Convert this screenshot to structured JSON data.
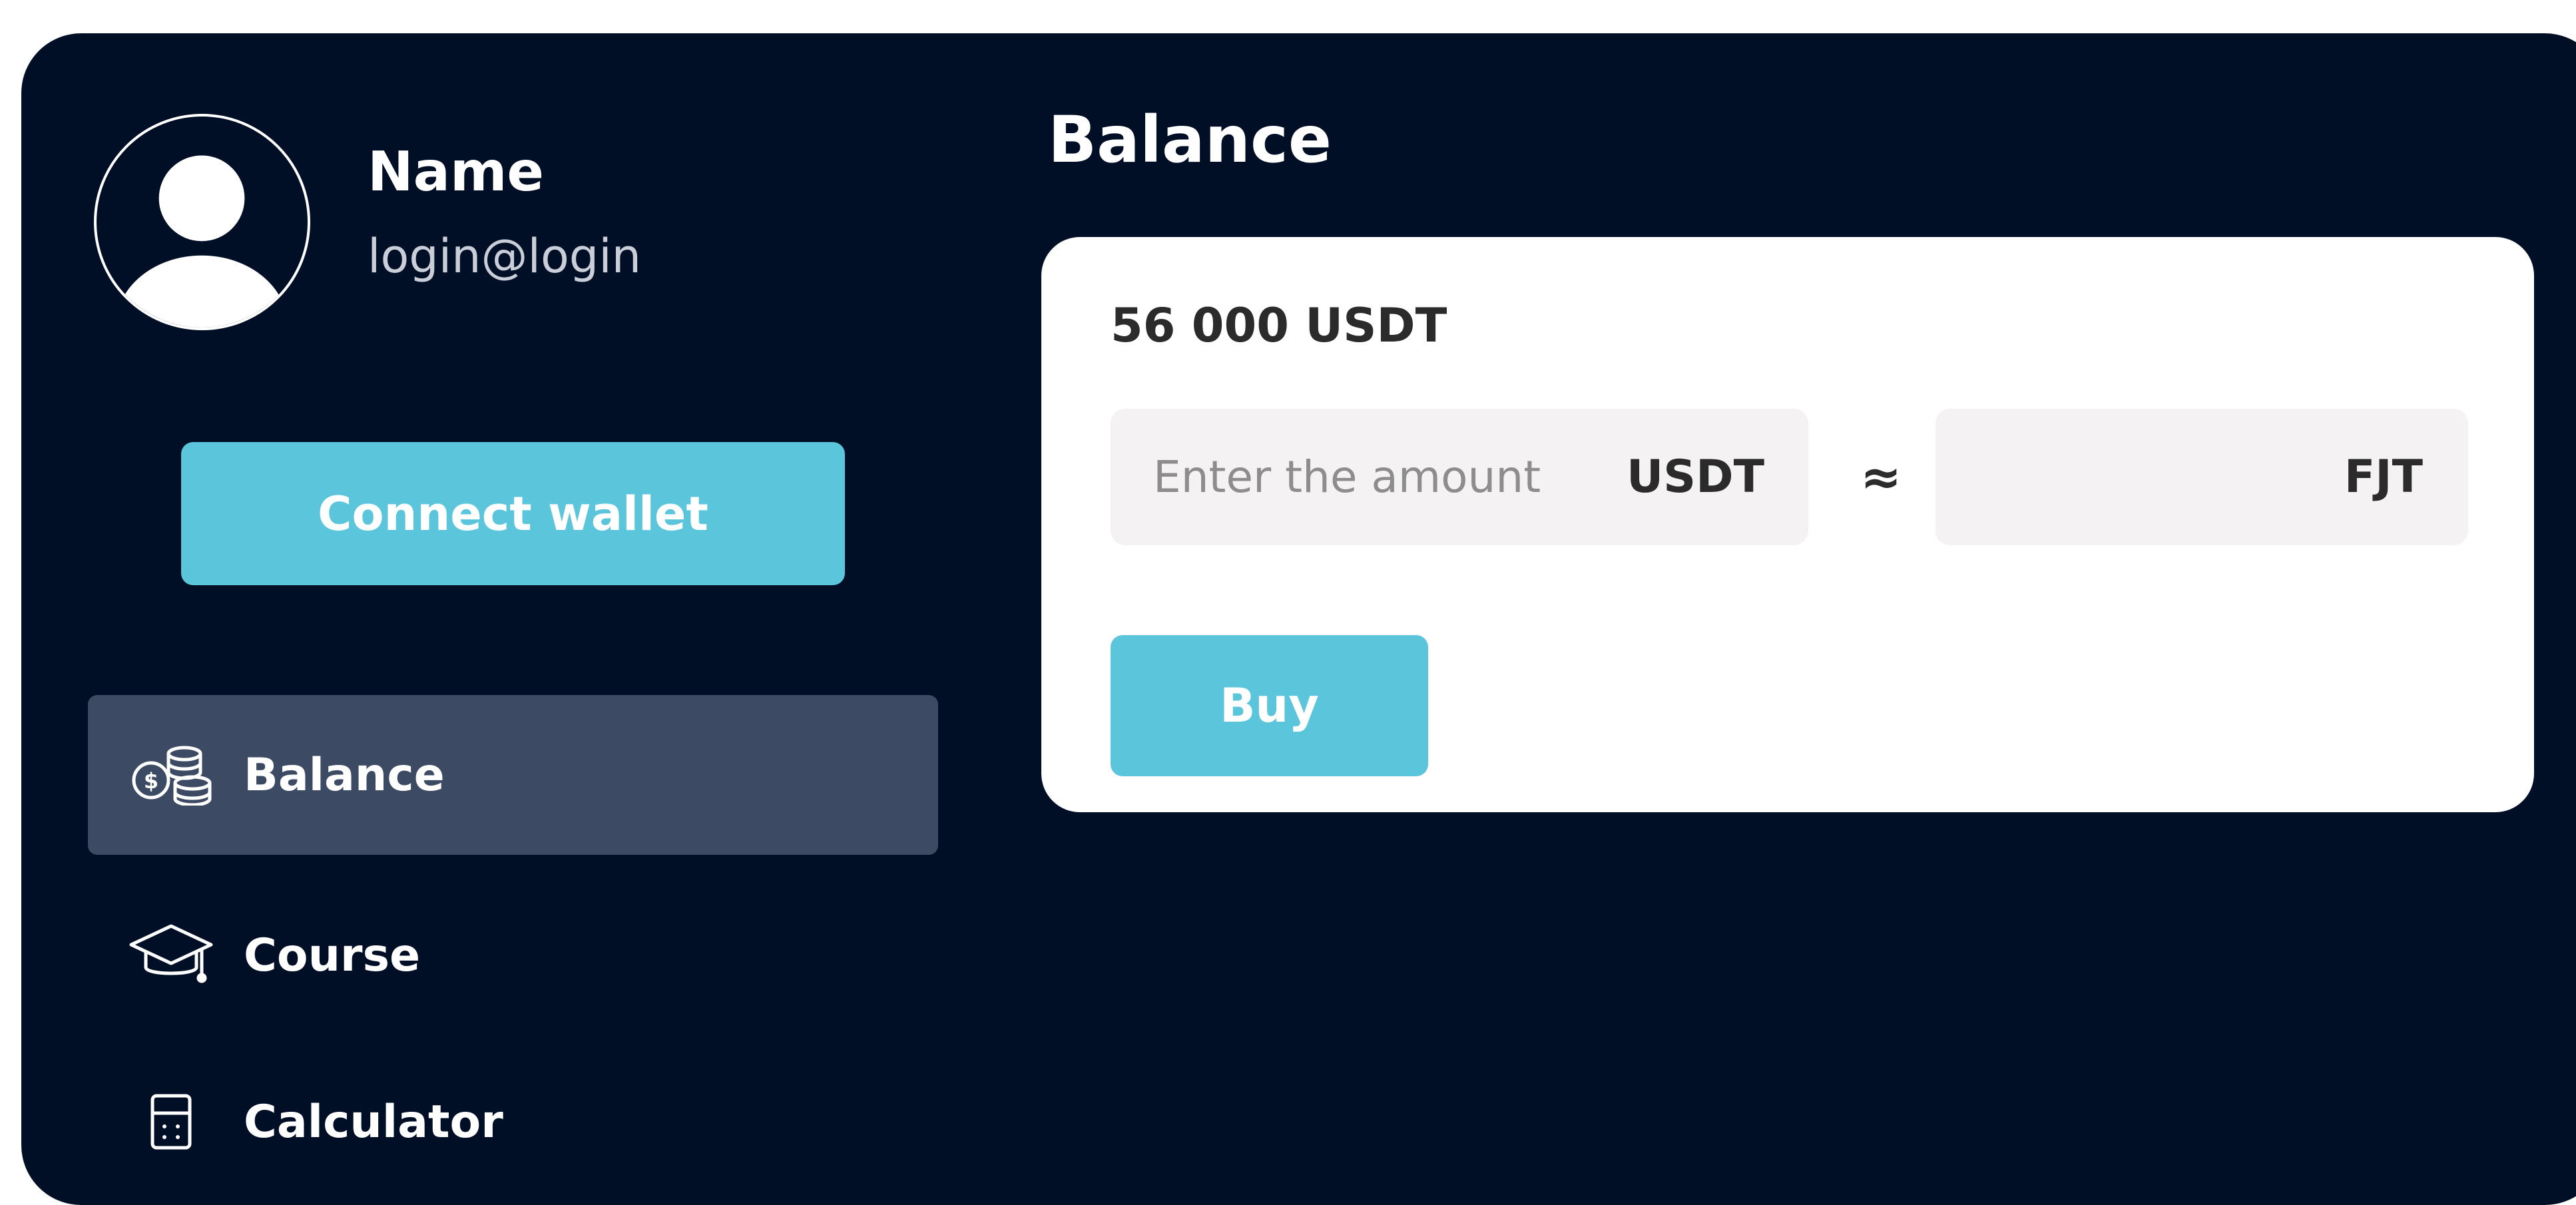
{
  "profile": {
    "avatar_icon": "user-avatar-icon",
    "name": "Name",
    "login": "login@login",
    "connect_label": "Connect wallet"
  },
  "sidebar": {
    "items": [
      {
        "label": "Balance",
        "icon": "coins-icon",
        "active": true
      },
      {
        "label": "Course",
        "icon": "graduation-cap-icon",
        "active": false
      },
      {
        "label": "Calculator",
        "icon": "calculator-icon",
        "active": false
      }
    ]
  },
  "main": {
    "title": "Balance",
    "balance": "56 000 USDT",
    "amount_placeholder": "Enter the amount",
    "amount_value": "",
    "from_currency": "USDT",
    "approx_symbol": "≈",
    "to_currency": "FJT",
    "result_value": "",
    "buy_label": "Buy"
  },
  "colors": {
    "background": "#000e26",
    "accent": "#5bc5dc",
    "active_nav": "#3c4a63",
    "card": "#ffffff",
    "input_bg": "#f4f2f3"
  }
}
